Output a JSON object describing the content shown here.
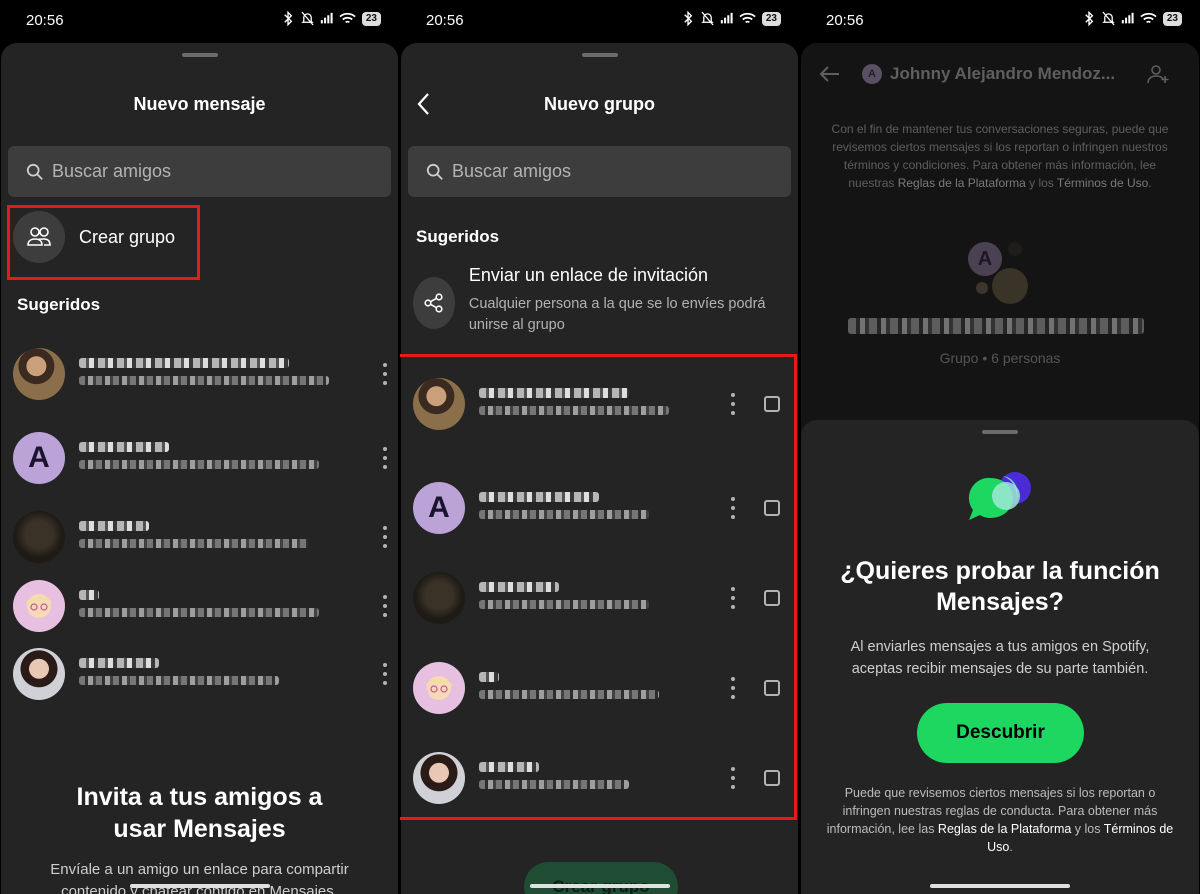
{
  "status_bar": {
    "time": "20:56",
    "battery": "23"
  },
  "screen1": {
    "title": "Nuevo mensaje",
    "search_placeholder": "Buscar amigos",
    "create_group_label": "Crear grupo",
    "suggested_title": "Sugeridos",
    "contacts": [
      {
        "avatar_type": "photo"
      },
      {
        "avatar_type": "letter",
        "letter": "A"
      },
      {
        "avatar_type": "dark"
      },
      {
        "avatar_type": "memoji"
      },
      {
        "avatar_type": "photo"
      }
    ],
    "invite_title": "Invita a tus amigos a usar Mensajes",
    "invite_subtitle": "Envíale a un amigo un enlace para compartir contenido y chatear contigo en Mensajes."
  },
  "screen2": {
    "title": "Nuevo grupo",
    "search_placeholder": "Buscar amigos",
    "suggested_title": "Sugeridos",
    "invite_link_title": "Enviar un enlace de invitación",
    "invite_link_subtitle": "Cualquier persona a la que se lo envíes podrá unirse al grupo",
    "contacts": [
      {
        "avatar_type": "photo"
      },
      {
        "avatar_type": "letter",
        "letter": "A"
      },
      {
        "avatar_type": "dark"
      },
      {
        "avatar_type": "memoji"
      },
      {
        "avatar_type": "photo"
      }
    ],
    "create_button": "Crear grupo"
  },
  "screen3": {
    "header_avatar_letter": "A",
    "header_name": "Johnny Alejandro Mendoz...",
    "notice_text": "Con el fin de mantener tus conversaciones seguras, puede que revisemos ciertos mensajes si los reportan o infringen nuestros términos y condiciones. Para obtener más información, lee nuestras ",
    "notice_link1": "Reglas de la Plataforma",
    "notice_mid": " y los ",
    "notice_link2": "Términos de Uso",
    "notice_end": ".",
    "group_avatar_letter": "A",
    "group_meta": "Grupo • 6 personas",
    "promo_title": "¿Quieres probar la función Mensajes?",
    "promo_subtitle": "Al enviarles mensajes a tus amigos en Spotify, aceptas recibir mensajes de su parte también.",
    "discover_button": "Descubrir",
    "footer_text": "Puede que revisemos ciertos mensajes si los reportan o infringen nuestras reglas de conducta. Para obtener más información, lee las ",
    "footer_link1": "Reglas de la Plataforma",
    "footer_mid": " y los ",
    "footer_link2": "Términos de Uso",
    "footer_end": "."
  },
  "colors": {
    "accent_green": "#1ed760",
    "highlight_red": "#e31b1b",
    "sheet_bg": "#242424"
  }
}
